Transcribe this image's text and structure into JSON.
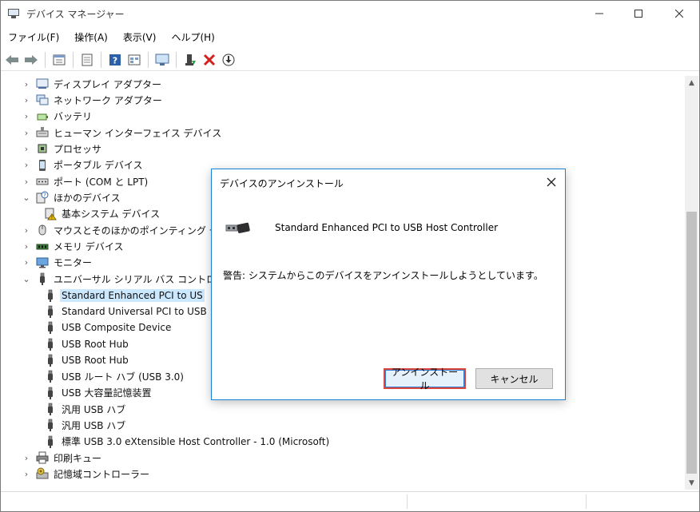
{
  "window": {
    "title": "デバイス マネージャー",
    "controls": {
      "minimize": "—",
      "maximize": "☐",
      "close": "✕"
    }
  },
  "menu": [
    "ファイル(F)",
    "操作(A)",
    "表示(V)",
    "ヘルプ(H)"
  ],
  "toolbar": [
    "back-arrow-icon",
    "forward-arrow-icon",
    "properties-icon",
    "show-hidden-icon",
    "help-icon",
    "scan-icon",
    "monitor-icon",
    "enable-device-icon",
    "uninstall-icon",
    "update-driver-icon"
  ],
  "tree": [
    {
      "label": "ディスプレイ アダプター",
      "expander": "›",
      "icon": "display-adapter-icon",
      "indent": 0
    },
    {
      "label": "ネットワーク アダプター",
      "expander": "›",
      "icon": "network-adapter-icon",
      "indent": 0
    },
    {
      "label": "バッテリ",
      "expander": "›",
      "icon": "battery-icon",
      "indent": 0
    },
    {
      "label": "ヒューマン インターフェイス デバイス",
      "expander": "›",
      "icon": "hid-icon",
      "indent": 0
    },
    {
      "label": "プロセッサ",
      "expander": "›",
      "icon": "processor-icon",
      "indent": 0
    },
    {
      "label": "ポータブル デバイス",
      "expander": "›",
      "icon": "portable-device-icon",
      "indent": 0
    },
    {
      "label": "ポート (COM と LPT)",
      "expander": "›",
      "icon": "port-icon",
      "indent": 0
    },
    {
      "label": "ほかのデバイス",
      "expander": "⌄",
      "icon": "other-device-icon",
      "indent": 0
    },
    {
      "label": "基本システム デバイス",
      "expander": "",
      "icon": "warning-device-icon",
      "indent": 1
    },
    {
      "label": "マウスとそのほかのポインティング デバ",
      "expander": "›",
      "icon": "mouse-icon",
      "indent": 0
    },
    {
      "label": "メモリ デバイス",
      "expander": "›",
      "icon": "memory-icon",
      "indent": 0
    },
    {
      "label": "モニター",
      "expander": "›",
      "icon": "monitor-icon",
      "indent": 0
    },
    {
      "label": "ユニバーサル シリアル バス コントローラ",
      "expander": "⌄",
      "icon": "usb-icon",
      "indent": 0
    },
    {
      "label": "Standard Enhanced PCI to US",
      "expander": "",
      "icon": "usb-icon",
      "indent": 1,
      "selected": true
    },
    {
      "label": "Standard Universal PCI to USB",
      "expander": "",
      "icon": "usb-icon",
      "indent": 1
    },
    {
      "label": "USB Composite Device",
      "expander": "",
      "icon": "usb-icon",
      "indent": 1
    },
    {
      "label": "USB Root Hub",
      "expander": "",
      "icon": "usb-icon",
      "indent": 1
    },
    {
      "label": "USB Root Hub",
      "expander": "",
      "icon": "usb-icon",
      "indent": 1
    },
    {
      "label": "USB ルート ハブ (USB 3.0)",
      "expander": "",
      "icon": "usb-icon",
      "indent": 1
    },
    {
      "label": "USB 大容量記憶装置",
      "expander": "",
      "icon": "usb-icon",
      "indent": 1
    },
    {
      "label": "汎用 USB ハブ",
      "expander": "",
      "icon": "usb-icon",
      "indent": 1
    },
    {
      "label": "汎用 USB ハブ",
      "expander": "",
      "icon": "usb-icon",
      "indent": 1
    },
    {
      "label": "標準 USB 3.0 eXtensible Host Controller - 1.0 (Microsoft)",
      "expander": "",
      "icon": "usb-icon",
      "indent": 1
    },
    {
      "label": "印刷キュー",
      "expander": "›",
      "icon": "print-queue-icon",
      "indent": 0
    },
    {
      "label": "記憶域コントローラー",
      "expander": "›",
      "icon": "storage-controller-icon",
      "indent": 0
    }
  ],
  "dialog": {
    "title": "デバイスのアンインストール",
    "device_name": "Standard Enhanced PCI to USB Host Controller",
    "warning": "警告: システムからこのデバイスをアンインストールしようとしています。",
    "uninstall_label": "アンインストール",
    "cancel_label": "キャンセル",
    "close_glyph": "✕"
  },
  "colors": {
    "selection": "#cce8ff",
    "dialog_border": "#1883d7",
    "highlight_box": "#d9483b"
  }
}
